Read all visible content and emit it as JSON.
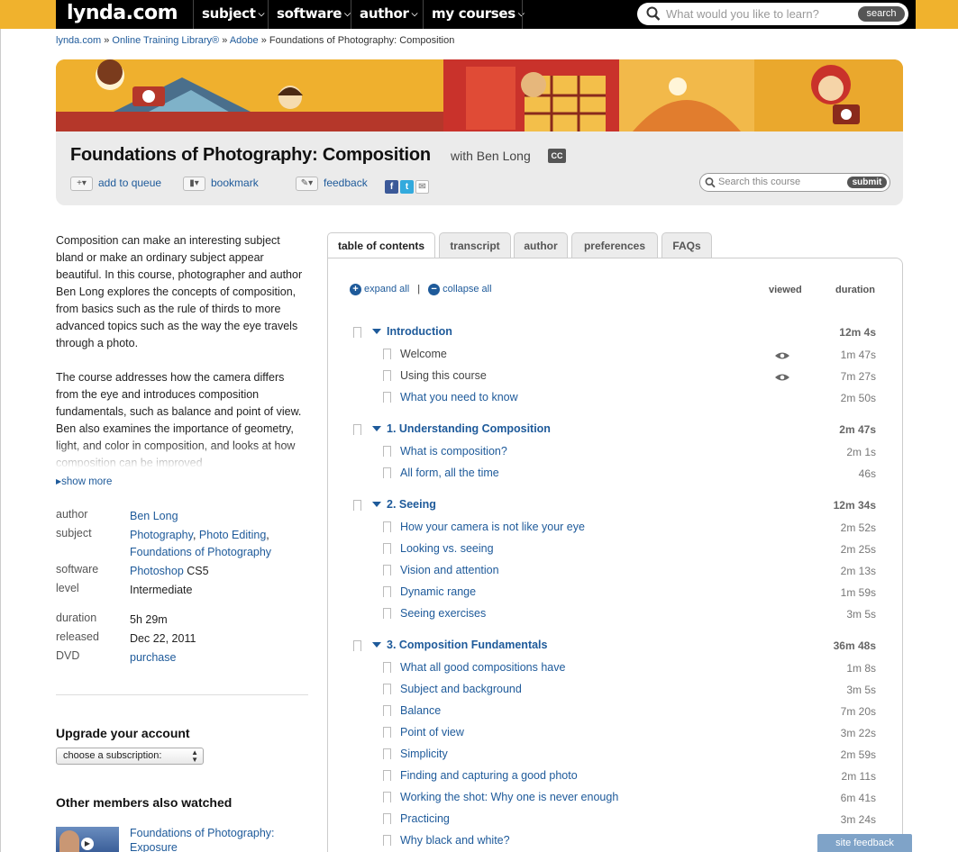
{
  "nav": {
    "logo": "lynda.com",
    "items": [
      {
        "label": "subject"
      },
      {
        "label": "software"
      },
      {
        "label": "author"
      },
      {
        "label": "my courses"
      }
    ],
    "search_placeholder": "What would you like to learn?",
    "search_button": "search"
  },
  "breadcrumb": {
    "home": "lynda.com",
    "sep": "»",
    "library": "Online Training Library®",
    "vendor": "Adobe",
    "current": "Foundations of Photography: Composition"
  },
  "course": {
    "title": "Foundations of Photography: Composition",
    "byline": "with Ben Long",
    "cc_badge": "CC",
    "actions": {
      "queue": "add to queue",
      "bookmark": "bookmark",
      "feedback": "feedback"
    },
    "social": {
      "facebook": "f",
      "twitter": "t",
      "email": "✉"
    },
    "search_placeholder": "Search this course",
    "search_button": "submit"
  },
  "description": {
    "p1": "Composition can make an interesting subject bland or make an ordinary subject appear beautiful. In this course, photographer and author Ben Long explores the concepts of composition, from basics such as the rule of thirds to more advanced topics such as the way the eye travels through a photo.",
    "p2": "The course addresses how the camera differs from the eye and introduces composition fundamentals, such as balance and point of view. Ben also examines the importance of geometry, light, and color in composition, and looks at how composition can be improved",
    "show_more": "show more"
  },
  "meta": {
    "author_k": "author",
    "author_v": "Ben Long",
    "subject_k": "subject",
    "subject_v1": "Photography",
    "subject_v2": "Photo Editing",
    "subject_v3": "Foundations of Photography",
    "software_k": "software",
    "software_v1": "Photoshop",
    "software_v2": "CS5",
    "level_k": "level",
    "level_v": "Intermediate",
    "duration_k": "duration",
    "duration_v": "5h 29m",
    "released_k": "released",
    "released_v": "Dec 22, 2011",
    "dvd_k": "DVD",
    "dvd_v": "purchase"
  },
  "upgrade": {
    "title": "Upgrade your account",
    "select_value": "choose a subscription:"
  },
  "other": {
    "title": "Other members also watched",
    "link": "Foundations of Photography: Exposure"
  },
  "tabs": [
    {
      "label": "table of contents"
    },
    {
      "label": "transcript"
    },
    {
      "label": "author"
    },
    {
      "label": "preferences"
    },
    {
      "label": "FAQs"
    }
  ],
  "toc": {
    "expand_all": "expand all",
    "sep": "|",
    "collapse_all": "collapse all",
    "col_viewed": "viewed",
    "col_duration": "duration",
    "chapters": [
      {
        "title": "Introduction",
        "duration": "12m 4s",
        "videos": [
          {
            "title": "Welcome",
            "duration": "1m 47s",
            "viewed": true
          },
          {
            "title": "Using this course",
            "duration": "7m 27s",
            "viewed": true
          },
          {
            "title": "What you need to know",
            "duration": "2m 50s",
            "viewed": false
          }
        ]
      },
      {
        "title": "1. Understanding Composition",
        "duration": "2m 47s",
        "videos": [
          {
            "title": "What is composition?",
            "duration": "2m 1s",
            "viewed": false
          },
          {
            "title": "All form, all the time",
            "duration": "46s",
            "viewed": false
          }
        ]
      },
      {
        "title": "2. Seeing",
        "duration": "12m 34s",
        "videos": [
          {
            "title": "How your camera is not like your eye",
            "duration": "2m 52s",
            "viewed": false
          },
          {
            "title": "Looking vs. seeing",
            "duration": "2m 25s",
            "viewed": false
          },
          {
            "title": "Vision and attention",
            "duration": "2m 13s",
            "viewed": false
          },
          {
            "title": "Dynamic range",
            "duration": "1m 59s",
            "viewed": false
          },
          {
            "title": "Seeing exercises",
            "duration": "3m 5s",
            "viewed": false
          }
        ]
      },
      {
        "title": "3. Composition Fundamentals",
        "duration": "36m 48s",
        "videos": [
          {
            "title": "What all good compositions have",
            "duration": "1m 8s",
            "viewed": false
          },
          {
            "title": "Subject and background",
            "duration": "3m 5s",
            "viewed": false
          },
          {
            "title": "Balance",
            "duration": "7m 20s",
            "viewed": false
          },
          {
            "title": "Point of view",
            "duration": "3m 22s",
            "viewed": false
          },
          {
            "title": "Simplicity",
            "duration": "2m 59s",
            "viewed": false
          },
          {
            "title": "Finding and capturing a good photo",
            "duration": "2m 11s",
            "viewed": false
          },
          {
            "title": "Working the shot: Why one is never enough",
            "duration": "6m 41s",
            "viewed": false
          },
          {
            "title": "Practicing",
            "duration": "3m 24s",
            "viewed": false
          },
          {
            "title": "Why black and white?",
            "duration": "",
            "viewed": false
          }
        ]
      }
    ]
  },
  "site_feedback": "site feedback",
  "colors": {
    "accent": "#1e5a9a",
    "brand_gold": "#f0b22d",
    "topbar": "#000000"
  }
}
